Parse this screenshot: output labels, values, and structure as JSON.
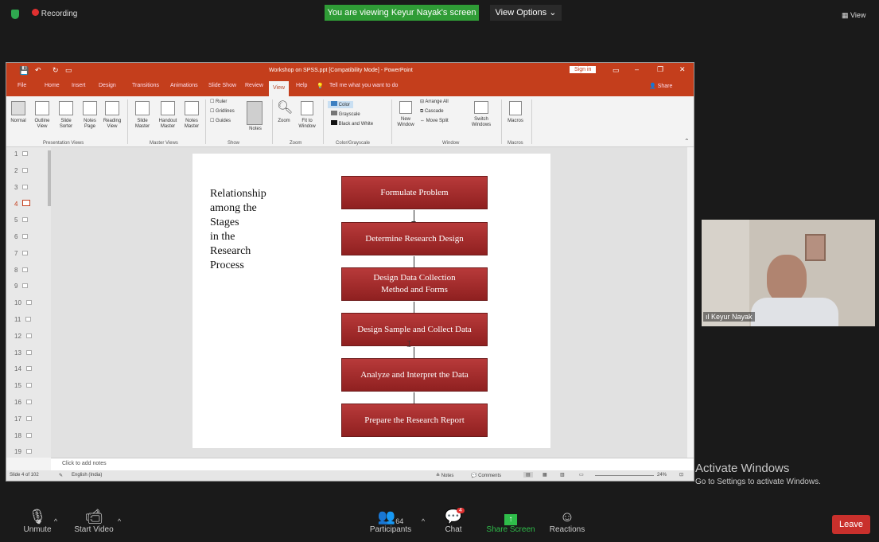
{
  "zoom_top": {
    "recording_label": "Recording",
    "viewing_banner": "You are viewing Keyur Nayak's screen",
    "view_options": "View Options ⌄",
    "view_label": "View"
  },
  "ppt": {
    "title": "Workshop on SPSS.ppt [Compatibility Mode] - PowerPoint",
    "sign_in": "Sign in",
    "share": "Share",
    "tabs": [
      "File",
      "Home",
      "Insert",
      "Design",
      "Transitions",
      "Animations",
      "Slide Show",
      "Review",
      "View",
      "Help"
    ],
    "active_tab": "View",
    "tell_me": "Tell me what you want to do",
    "ribbon": {
      "presentation_views": [
        "Normal",
        "Outline View",
        "Slide Sorter",
        "Notes Page",
        "Reading View"
      ],
      "master_views": [
        "Slide Master",
        "Handout Master",
        "Notes Master"
      ],
      "show": [
        "Ruler",
        "Gridlines",
        "Guides"
      ],
      "notes": "Notes",
      "zoom": [
        "Zoom",
        "Fit to Window"
      ],
      "color": [
        "Color",
        "Grayscale",
        "Black and White"
      ],
      "window": [
        "New Window",
        "Arrange All",
        "Cascade",
        "Move Split",
        "Switch Windows"
      ],
      "macros": "Macros",
      "group_labels": [
        "Presentation Views",
        "Master Views",
        "Show",
        "Zoom",
        "Color/Grayscale",
        "Window",
        "Macros"
      ]
    },
    "slide_numbers": [
      "1",
      "2",
      "3",
      "4",
      "5",
      "6",
      "7",
      "8",
      "9",
      "10",
      "11",
      "12",
      "13",
      "14",
      "15",
      "16",
      "17",
      "18",
      "19"
    ],
    "current_slide": "4",
    "slide": {
      "left_text": "Relationship\namong the\nStages\nin the\nResearch\nProcess",
      "stages": [
        "Formulate Problem",
        "Determine Research Design",
        "Design Data Collection\nMethod and Forms",
        "Design Sample and Collect Data",
        "Analyze and Interpret the Data",
        "Prepare the Research Report"
      ]
    },
    "notes_placeholder": "Click to add notes",
    "status_left": "Slide 4 of 102",
    "status_lang": "English (India)",
    "status_notes": "Notes",
    "status_comments": "Comments",
    "zoom_level": "24%"
  },
  "video": {
    "name": "Keyur Nayak"
  },
  "activate": {
    "title": "Activate Windows",
    "sub": "Go to Settings to activate Windows."
  },
  "toolbar": {
    "unmute": "Unmute",
    "start_video": "Start Video",
    "participants": "Participants",
    "participants_count": "64",
    "chat": "Chat",
    "chat_badge": "4",
    "share_screen": "Share Screen",
    "reactions": "Reactions",
    "leave": "Leave"
  },
  "colors": {
    "ppt_accent": "#c43e1c",
    "share_green": "#2f9c36",
    "stage_red": "#a52a2a",
    "leave_red": "#c9302c"
  }
}
